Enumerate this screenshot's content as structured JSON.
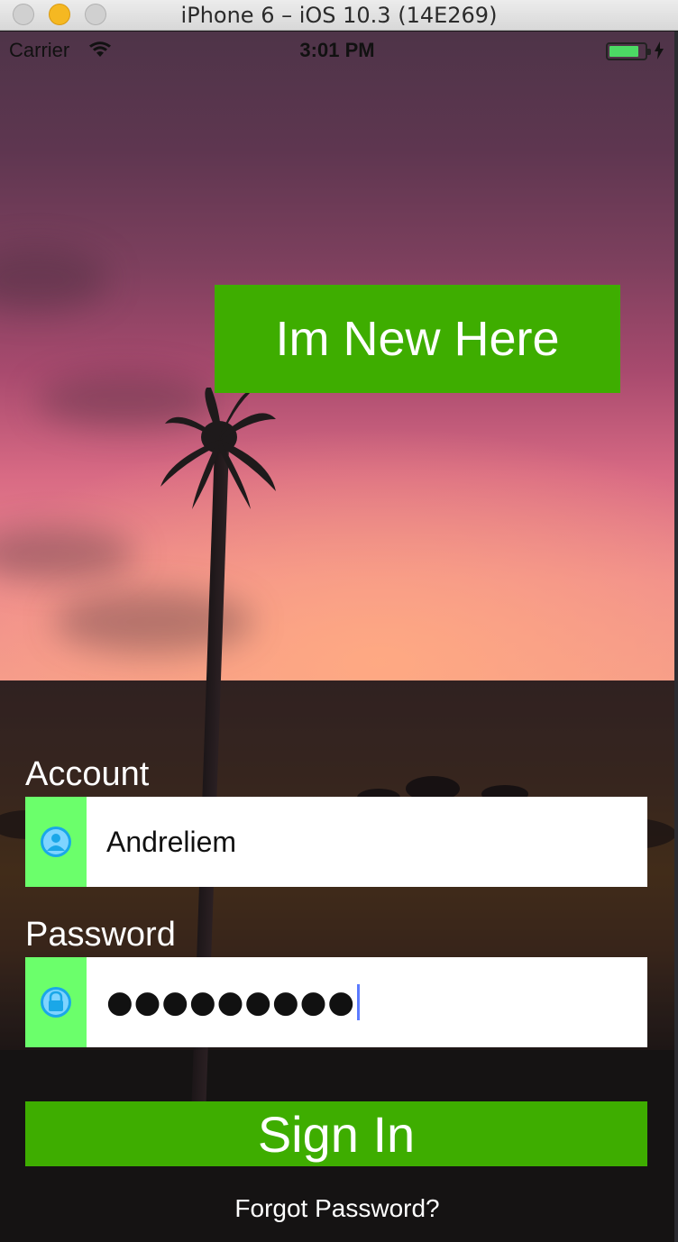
{
  "window": {
    "title": "iPhone 6 – iOS 10.3 (14E269)"
  },
  "status_bar": {
    "carrier": "Carrier",
    "time": "3:01 PM",
    "battery_level": 0.85
  },
  "new_here_button": {
    "label": "Im New Here"
  },
  "account": {
    "label": "Account",
    "value": "Andreliem",
    "icon": "user-icon"
  },
  "password": {
    "label": "Password",
    "masked_value": "●●●●●●●●●",
    "icon": "lock-icon"
  },
  "signin_button": {
    "label": "Sign In"
  },
  "forgot_link": {
    "label": "Forgot Password?"
  },
  "colors": {
    "primary_green": "#3ead00",
    "icon_box_green": "#6bff6b",
    "icon_cyan": "#1aa7e8"
  }
}
